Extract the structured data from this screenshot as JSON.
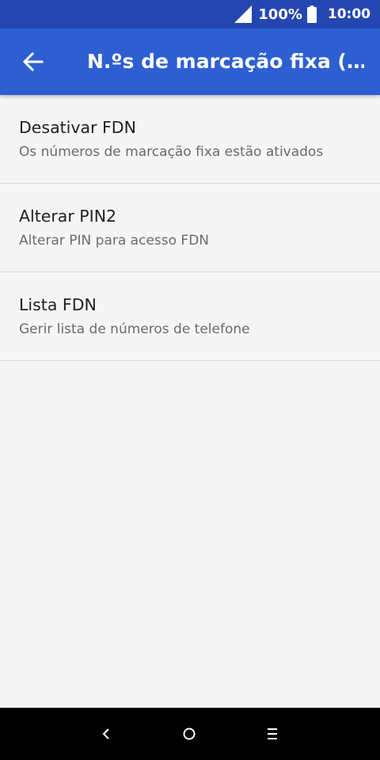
{
  "status_bar": {
    "battery_percent": "100%",
    "time": "10:00",
    "icons": [
      "signal-icon",
      "battery-icon"
    ]
  },
  "app_bar": {
    "title": "N.ºs de marcação fixa (…",
    "back_icon": "arrow-left-icon"
  },
  "settings": {
    "items": [
      {
        "title": "Desativar FDN",
        "subtitle": "Os números de marcação fixa estão ativados"
      },
      {
        "title": "Alterar PIN2",
        "subtitle": "Alterar PIN para acesso FDN"
      },
      {
        "title": "Lista FDN",
        "subtitle": "Gerir lista de números de telefone"
      }
    ]
  },
  "nav_bar": {
    "icons": [
      "back-chevron-icon",
      "home-circle-icon",
      "menu-lines-icon"
    ]
  },
  "colors": {
    "status_bar": "#2446b1",
    "app_bar": "#2d5fd3",
    "background": "#f5f5f5",
    "divider": "#d8d8d8",
    "nav_bar": "#000000"
  }
}
